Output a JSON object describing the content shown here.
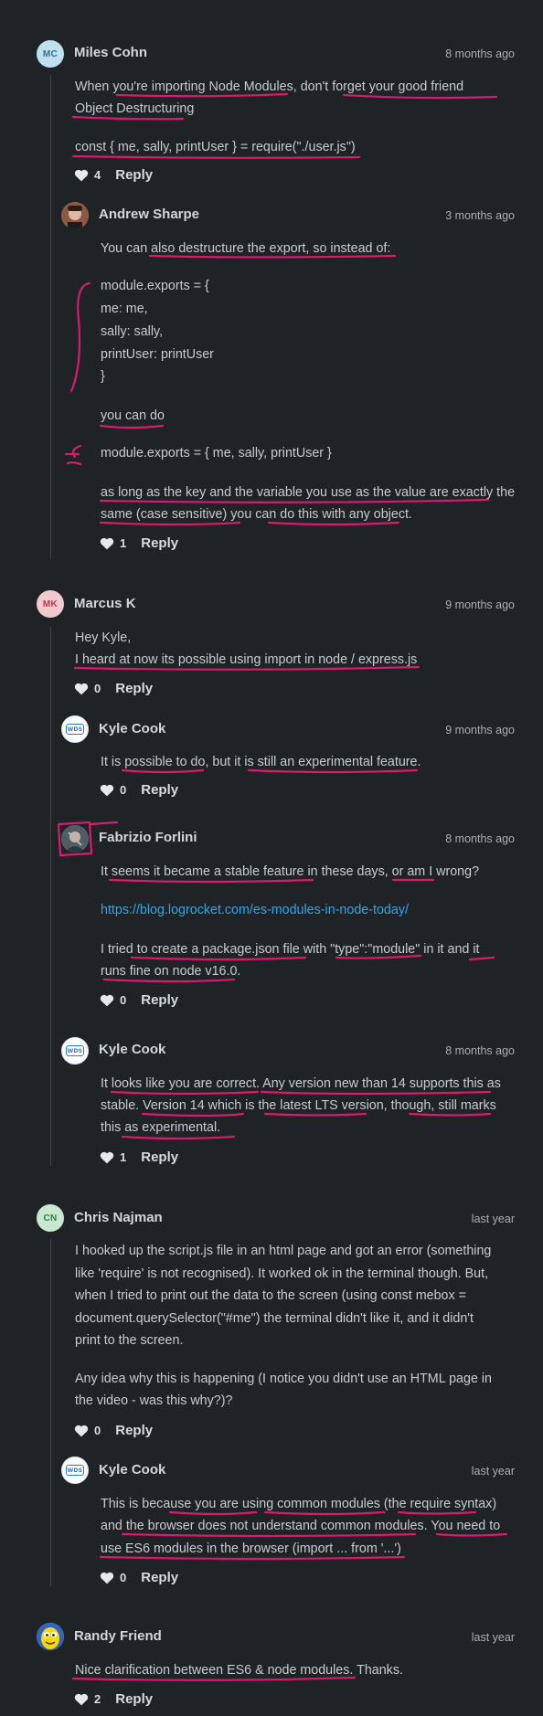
{
  "comments": [
    {
      "avatar_initials": "MC",
      "author": "Miles Cohn",
      "time": "8 months ago",
      "lines": [
        "When you're importing Node Modules, don't forget your good friend",
        "Object Destructuring",
        "",
        "const { me, sally, printUser } = require(\"./user.js\")"
      ],
      "likes": "4",
      "reply_label": "Reply",
      "replies": [
        {
          "author": "Andrew Sharpe",
          "time": "3 months ago",
          "lines": [
            "You can also destructure the export, so instead of:",
            "",
            "module.exports = {",
            "me: me,",
            "sally: sally,",
            "printUser: printUser",
            "}",
            "",
            "you can do",
            "",
            "module.exports = { me, sally, printUser }",
            "",
            "as long as the key and the variable you use as the value are exactly the",
            "same (case sensitive) you can do this with any object."
          ],
          "likes": "1",
          "reply_label": "Reply"
        }
      ]
    },
    {
      "avatar_initials": "MK",
      "author": "Marcus K",
      "time": "9 months ago",
      "lines": [
        "Hey Kyle,",
        "I heard at now its possible using import in node / express.js"
      ],
      "likes": "0",
      "reply_label": "Reply",
      "replies": [
        {
          "author": "Kyle Cook",
          "time": "9 months ago",
          "lines": [
            "It is possible to do, but it is still an experimental feature."
          ],
          "likes": "0",
          "reply_label": "Reply"
        },
        {
          "author": "Fabrizio Forlini",
          "time": "8 months ago",
          "lines": [
            "It seems it became a stable feature in these days, or am I wrong?",
            "",
            "https://blog.logrocket.com/es-modules-in-node-today/",
            "",
            "I tried to create a package.json file with \"type\":\"module\" in it and it",
            "runs fine on node v16.0."
          ],
          "likes": "0",
          "reply_label": "Reply"
        },
        {
          "author": "Kyle Cook",
          "time": "8 months ago",
          "lines": [
            "It looks like you are correct. Any version new than 14 supports this as",
            "stable. Version 14 which is the latest LTS version, though, still marks",
            "this as experimental."
          ],
          "likes": "1",
          "reply_label": "Reply"
        }
      ]
    },
    {
      "avatar_initials": "CN",
      "author": "Chris Najman",
      "time": "last year",
      "lines": [
        "I hooked up the script.js file in an html page and got an error (something",
        "like 'require' is not recognised). It worked ok in the terminal though. But,",
        "when I tried to print out the data to the screen (using const mebox =",
        "document.querySelector(\"#me\") the terminal didn't like it, and it didn't",
        "print to the screen.",
        "",
        "Any idea why this is happening (I notice you didn't use an HTML page in",
        "the video - was this why?)?"
      ],
      "likes": "0",
      "reply_label": "Reply",
      "replies": [
        {
          "author": "Kyle Cook",
          "time": "last year",
          "lines": [
            "This is because you are using common modules (the require syntax)",
            "and the browser does not understand common modules. You need to",
            "use ES6 modules in the browser (import ... from '...')"
          ],
          "likes": "0",
          "reply_label": "Reply"
        }
      ]
    },
    {
      "author": "Randy Friend",
      "time": "last year",
      "lines": [
        "Nice clarification between ES6 & node modules. Thanks."
      ],
      "likes": "2",
      "reply_label": "Reply"
    }
  ],
  "wds_badge": "WDS",
  "colors": {
    "background": "#202326",
    "link": "#2fa7e6",
    "annotation": "#d81b70"
  }
}
